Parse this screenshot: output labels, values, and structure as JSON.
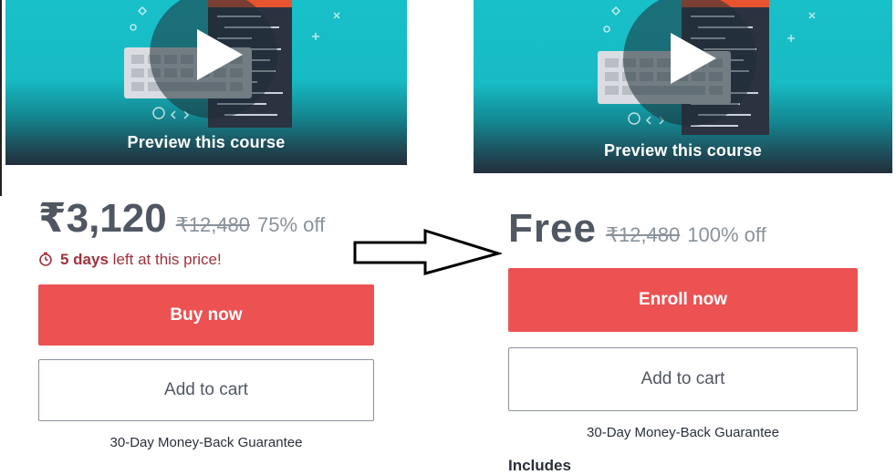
{
  "left": {
    "preview_label": "Preview this course",
    "price": "₹3,120",
    "original_price": "₹12,480",
    "discount": "75% off",
    "deadline_bold": "5 days",
    "deadline_rest": "left at this price!",
    "buy_label": "Buy now",
    "cart_label": "Add to cart",
    "guarantee": "30-Day Money-Back Guarantee"
  },
  "right": {
    "preview_label": "Preview this course",
    "price": "Free",
    "original_price": "₹12,480",
    "discount": "100% off",
    "enroll_label": "Enroll now",
    "cart_label": "Add to cart",
    "guarantee": "30-Day Money-Back Guarantee",
    "includes_label": "Includes"
  },
  "icons": {
    "play": "play-icon",
    "timer": "alarm-clock-icon",
    "arrow": "right-arrow-icon"
  },
  "colors": {
    "accent_red": "#ec5252",
    "deadline_red": "#a1313b",
    "preview_teal": "#18c0c9",
    "price_gray": "#505763",
    "muted_gray": "#8a929b"
  }
}
